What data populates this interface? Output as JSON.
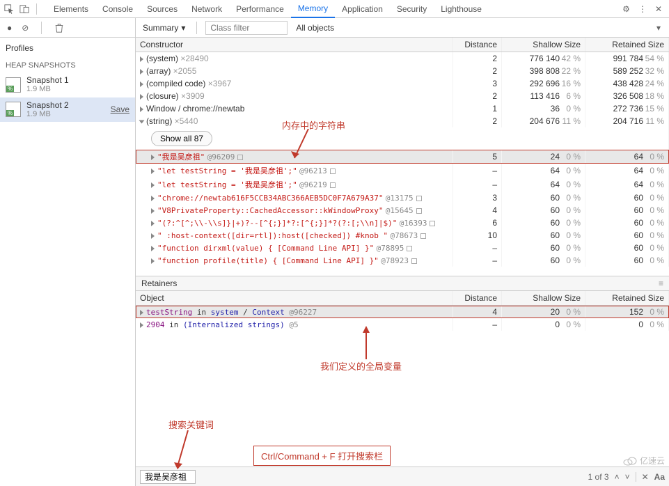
{
  "toolbar": {
    "tabs": [
      "Elements",
      "Console",
      "Sources",
      "Network",
      "Performance",
      "Memory",
      "Application",
      "Security",
      "Lighthouse"
    ],
    "active_tab": 5
  },
  "subbar": {
    "view_label": "Summary",
    "filter_placeholder": "Class filter",
    "scope_label": "All objects"
  },
  "profiles": {
    "header": "Profiles",
    "category": "HEAP SNAPSHOTS",
    "snapshots": [
      {
        "name": "Snapshot 1",
        "size": "1.9 MB",
        "selected": false,
        "save": ""
      },
      {
        "name": "Snapshot 2",
        "size": "1.9 MB",
        "selected": true,
        "save": "Save"
      }
    ]
  },
  "constructors": {
    "headers": [
      "Constructor",
      "Distance",
      "Shallow Size",
      "Retained Size"
    ],
    "show_all_label": "Show all 87",
    "top": [
      {
        "name": "(system)",
        "count": "×28490",
        "dist": "2",
        "shallow": "776 140",
        "shallow_pct": "42 %",
        "ret": "991 784",
        "ret_pct": "54 %"
      },
      {
        "name": "(array)",
        "count": "×2055",
        "dist": "2",
        "shallow": "398 808",
        "shallow_pct": "22 %",
        "ret": "589 252",
        "ret_pct": "32 %"
      },
      {
        "name": "(compiled code)",
        "count": "×3967",
        "dist": "3",
        "shallow": "292 696",
        "shallow_pct": "16 %",
        "ret": "438 428",
        "ret_pct": "24 %"
      },
      {
        "name": "(closure)",
        "count": "×3909",
        "dist": "2",
        "shallow": "113 416",
        "shallow_pct": "6 %",
        "ret": "326 508",
        "ret_pct": "18 %"
      },
      {
        "name": "Window / chrome://newtab",
        "count": "",
        "dist": "1",
        "shallow": "36",
        "shallow_pct": "0 %",
        "ret": "272 736",
        "ret_pct": "15 %"
      },
      {
        "name": "(string)",
        "count": "×5440",
        "dist": "2",
        "shallow": "204 676",
        "shallow_pct": "11 %",
        "ret": "204 716",
        "ret_pct": "11 %",
        "open": true
      }
    ],
    "strings": [
      {
        "text": "\"我是吴彦祖\"",
        "id": "@96209",
        "box": true,
        "selected": true,
        "dist": "5",
        "shallow": "24",
        "shallow_pct": "0 %",
        "ret": "64",
        "ret_pct": "0 %"
      },
      {
        "text": "\"let testString = '我是吴彦祖';\"",
        "id": "@96213",
        "box": true,
        "dist": "–",
        "shallow": "64",
        "shallow_pct": "0 %",
        "ret": "64",
        "ret_pct": "0 %"
      },
      {
        "text": "\"let testString = '我是吴彦祖';\"",
        "id": "@96219",
        "box": true,
        "dist": "–",
        "shallow": "64",
        "shallow_pct": "0 %",
        "ret": "64",
        "ret_pct": "0 %"
      },
      {
        "text": "\"chrome://newtab616F5CCB34ABC366AEB5DC0F7A679A37\"",
        "id": "@13175",
        "box": true,
        "dist": "3",
        "shallow": "60",
        "shallow_pct": "0 %",
        "ret": "60",
        "ret_pct": "0 %"
      },
      {
        "text": "\"V8PrivateProperty::CachedAccessor::kWindowProxy\"",
        "id": "@15645",
        "box": true,
        "dist": "4",
        "shallow": "60",
        "shallow_pct": "0 %",
        "ret": "60",
        "ret_pct": "0 %"
      },
      {
        "text": "\"(?:^[^;\\\\-\\\\s]}|+)?--[^{;}]*?:[^{;}]*?(?:[;\\\\n]|$)\"",
        "id": "@16393",
        "box": true,
        "dist": "6",
        "shallow": "60",
        "shallow_pct": "0 %",
        "ret": "60",
        "ret_pct": "0 %"
      },
      {
        "text": "\" :host-context([dir=rtl]):host([checked]) #knob \"",
        "id": "@78673",
        "box": true,
        "dist": "10",
        "shallow": "60",
        "shallow_pct": "0 %",
        "ret": "60",
        "ret_pct": "0 %"
      },
      {
        "text": "\"function dirxml(value) { [Command Line API] }\"",
        "id": "@78895",
        "box": true,
        "dist": "–",
        "shallow": "60",
        "shallow_pct": "0 %",
        "ret": "60",
        "ret_pct": "0 %"
      },
      {
        "text": "\"function profile(title) { [Command Line API] }\"",
        "id": "@78923",
        "box": true,
        "dist": "–",
        "shallow": "60",
        "shallow_pct": "0 %",
        "ret": "60",
        "ret_pct": "0 %"
      }
    ]
  },
  "retainers": {
    "title": "Retainers",
    "headers": [
      "Object",
      "Distance",
      "Shallow Size",
      "Retained Size"
    ],
    "rows": [
      {
        "pre": "testString",
        "mid": " in ",
        "a": "system",
        "b": " / ",
        "c": "Context",
        "id": " @96227",
        "dist": "4",
        "shallow": "20",
        "shallow_pct": "0 %",
        "ret": "152",
        "ret_pct": "0 %",
        "selected": true
      },
      {
        "pre": "2904",
        "mid": " in ",
        "a": "(Internalized strings)",
        "b": "",
        "c": "",
        "id": " @5",
        "dist": "–",
        "shallow": "0",
        "shallow_pct": "0 %",
        "ret": "0",
        "ret_pct": "0 %",
        "selected": false
      }
    ]
  },
  "search": {
    "value": "我是吴彦祖",
    "counter": "1 of 3"
  },
  "annotations": {
    "a1": "内存中的字符串",
    "a2": "我们定义的全局变量",
    "a3": "搜索关键词",
    "a4": "Ctrl/Command + F 打开搜索栏"
  },
  "logo": "亿速云"
}
